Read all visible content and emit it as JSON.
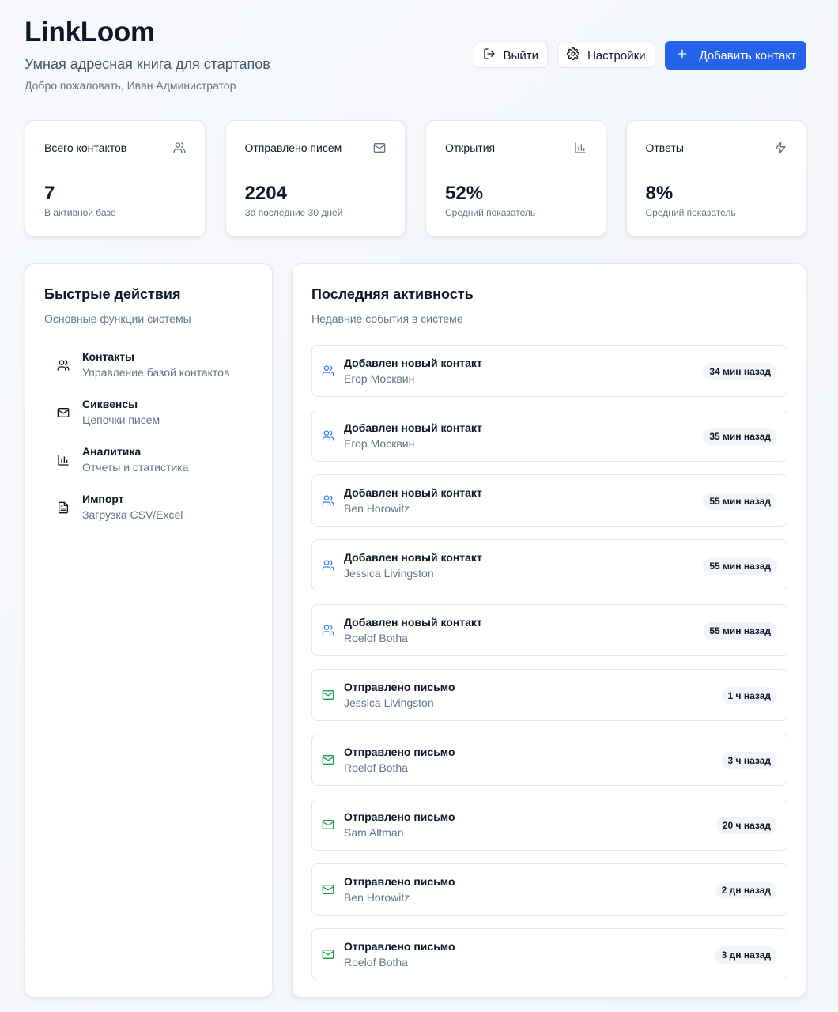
{
  "header": {
    "title": "LinkLoom",
    "subtitle": "Умная адресная книга для стартапов",
    "welcome": "Добро пожаловать, Иван Администратор",
    "logout_label": "Выйти",
    "settings_label": "Настройки",
    "add_contact_label": "Добавить контакт"
  },
  "stats": [
    {
      "label": "Всего контактов",
      "value": "7",
      "hint": "В активной базе",
      "icon": "users-icon"
    },
    {
      "label": "Отправлено писем",
      "value": "2204",
      "hint": "За последние 30 дней",
      "icon": "mail-icon"
    },
    {
      "label": "Открытия",
      "value": "52%",
      "hint": "Средний показатель",
      "icon": "bar-chart-icon"
    },
    {
      "label": "Ответы",
      "value": "8%",
      "hint": "Средний показатель",
      "icon": "zap-icon"
    }
  ],
  "quick_actions": {
    "title": "Быстрые действия",
    "subtitle": "Основные функции системы",
    "items": [
      {
        "name": "Контакты",
        "desc": "Управление базой контактов",
        "icon": "users-icon"
      },
      {
        "name": "Сиквенсы",
        "desc": "Цепочки писем",
        "icon": "mail-icon"
      },
      {
        "name": "Аналитика",
        "desc": "Отчеты и статистика",
        "icon": "bar-chart-icon"
      },
      {
        "name": "Импорт",
        "desc": "Загрузка CSV/Excel",
        "icon": "file-icon"
      }
    ]
  },
  "activity": {
    "title": "Последняя активность",
    "subtitle": "Недавние события в системе",
    "colors": {
      "contact": "#3b82f6",
      "mail": "#16a34a"
    },
    "items": [
      {
        "type": "contact",
        "title": "Добавлен новый контакт",
        "name": "Егор Москвин",
        "time": "34 мин назад"
      },
      {
        "type": "contact",
        "title": "Добавлен новый контакт",
        "name": "Егор Москвин",
        "time": "35 мин назад"
      },
      {
        "type": "contact",
        "title": "Добавлен новый контакт",
        "name": "Ben Horowitz",
        "time": "55 мин назад"
      },
      {
        "type": "contact",
        "title": "Добавлен новый контакт",
        "name": "Jessica Livingston",
        "time": "55 мин назад"
      },
      {
        "type": "contact",
        "title": "Добавлен новый контакт",
        "name": "Roelof Botha",
        "time": "55 мин назад"
      },
      {
        "type": "mail",
        "title": "Отправлено письмо",
        "name": "Jessica Livingston",
        "time": "1 ч назад"
      },
      {
        "type": "mail",
        "title": "Отправлено письмо",
        "name": "Roelof Botha",
        "time": "3 ч назад"
      },
      {
        "type": "mail",
        "title": "Отправлено письмо",
        "name": "Sam Altman",
        "time": "20 ч назад"
      },
      {
        "type": "mail",
        "title": "Отправлено письмо",
        "name": "Ben Horowitz",
        "time": "2 дн назад"
      },
      {
        "type": "mail",
        "title": "Отправлено письмо",
        "name": "Roelof Botha",
        "time": "3 дн назад"
      }
    ]
  },
  "colors": {
    "accent": "#2563eb",
    "text": "#0f172a",
    "muted": "#64748b"
  }
}
